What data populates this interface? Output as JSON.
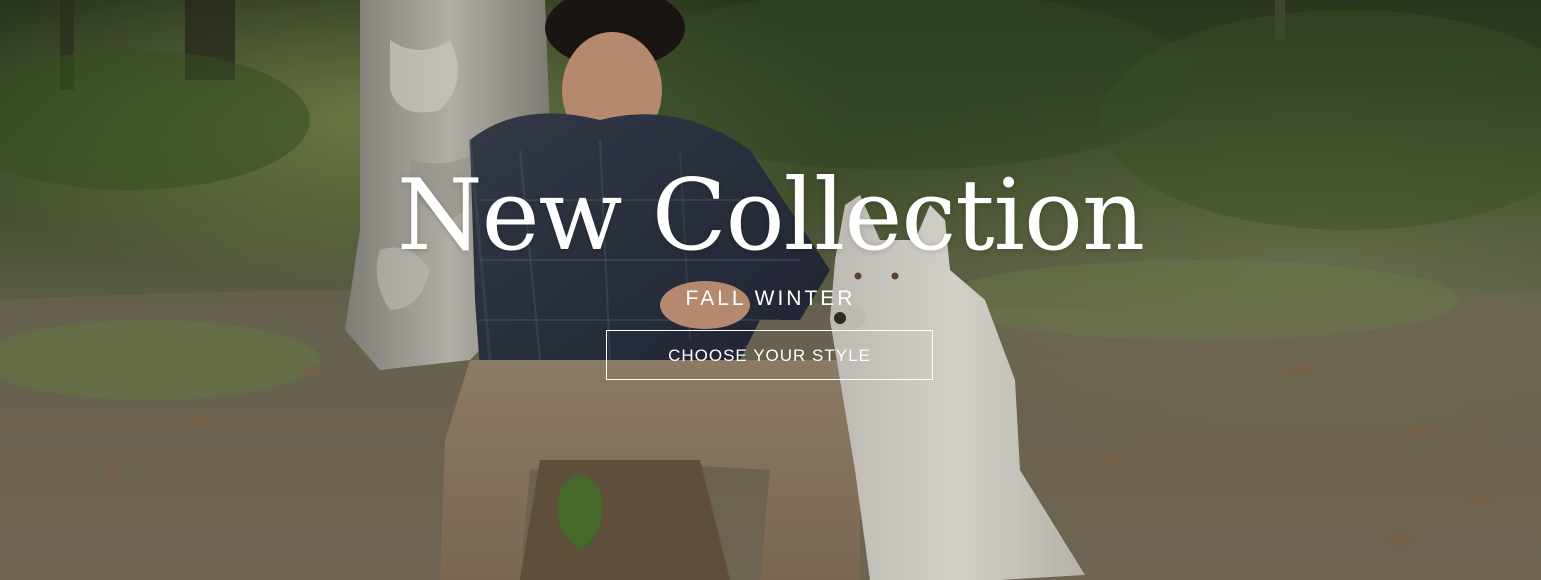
{
  "hero": {
    "title": "New Collection",
    "subtitle": "FALL WINTER",
    "cta_label": "CHOOSE YOUR STYLE"
  },
  "colors": {
    "text": "#ffffff",
    "foliage_dark": "#2f3a22",
    "foliage_light": "#6f8a4a",
    "ground": "#8a7b63"
  }
}
